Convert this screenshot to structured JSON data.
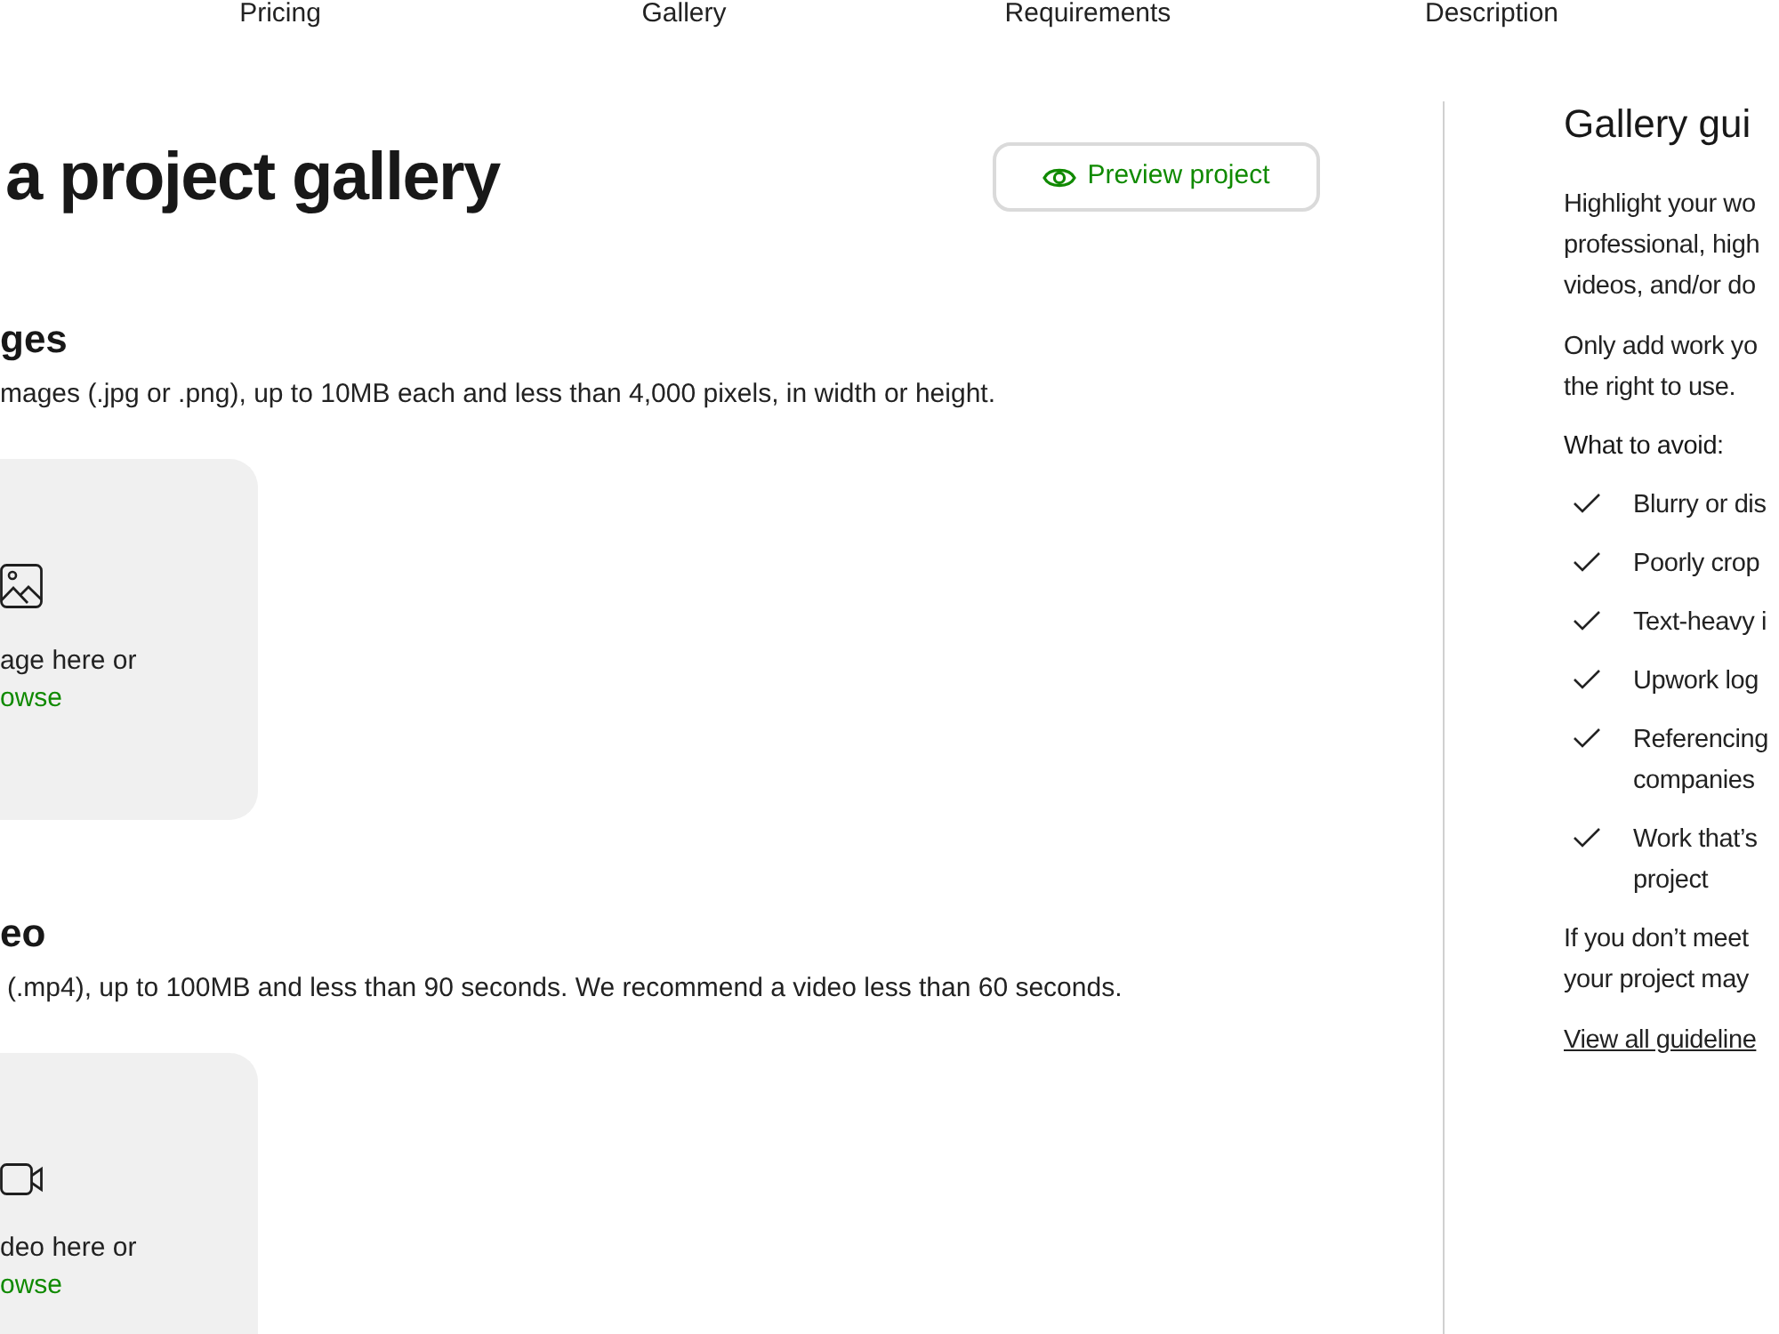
{
  "nav_tabs": [
    {
      "label": "Pricing"
    },
    {
      "label": "Gallery"
    },
    {
      "label": "Requirements"
    },
    {
      "label": "Description"
    }
  ],
  "header": {
    "title": "a project gallery",
    "preview_button": "Preview project"
  },
  "sections": [
    {
      "kind": "image",
      "heading": "ges",
      "description": "mages (.jpg or .png), up to 10MB each and less than 4,000 pixels, in width or height.",
      "drop_zone": {
        "prompt": "age here or",
        "link": "owse"
      }
    },
    {
      "kind": "video",
      "heading": "eo",
      "description": "(.mp4), up to 100MB and less than 90 seconds. We recommend a video less than 60 seconds.",
      "drop_zone": {
        "prompt": "deo here or",
        "link": "owse"
      }
    }
  ],
  "guidelines": {
    "title": "Gallery gui",
    "paragraphs": [
      {
        "lines": [
          "Highlight your wo",
          "professional, high",
          "videos, and/or do"
        ]
      },
      {
        "lines": [
          "Only add work yo",
          "the right to use."
        ]
      }
    ],
    "avoid_label": "What to avoid:",
    "avoid_items": [
      {
        "lines": [
          "Blurry or dis"
        ]
      },
      {
        "lines": [
          "Poorly crop"
        ]
      },
      {
        "lines": [
          "Text-heavy i"
        ]
      },
      {
        "lines": [
          "Upwork log"
        ]
      },
      {
        "lines": [
          "Referencing",
          "companies"
        ]
      },
      {
        "lines": [
          "Work that’s",
          "project"
        ]
      }
    ],
    "closing": {
      "lines": [
        "If you don’t meet",
        "your project may"
      ]
    },
    "link": "View all guideline"
  }
}
